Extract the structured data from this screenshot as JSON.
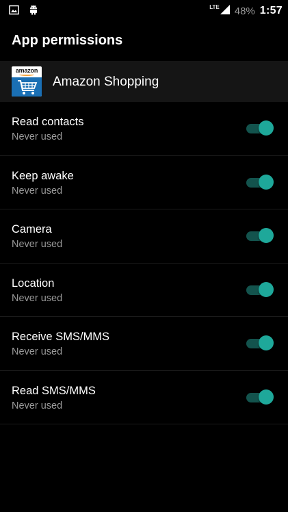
{
  "status_bar": {
    "network": "LTE",
    "battery": "48%",
    "time": "1:57"
  },
  "app_bar": {
    "title": "App permissions"
  },
  "app": {
    "name": "Amazon Shopping",
    "icon_logo_text": "amazon"
  },
  "permissions": [
    {
      "label": "Read contacts",
      "status": "Never used",
      "enabled": true
    },
    {
      "label": "Keep awake",
      "status": "Never used",
      "enabled": true
    },
    {
      "label": "Camera",
      "status": "Never used",
      "enabled": true
    },
    {
      "label": "Location",
      "status": "Never used",
      "enabled": true
    },
    {
      "label": "Receive SMS/MMS",
      "status": "Never used",
      "enabled": true
    },
    {
      "label": "Read SMS/MMS",
      "status": "Never used",
      "enabled": true
    }
  ],
  "colors": {
    "toggle_thumb": "#1ea89a",
    "toggle_track": "#13534d",
    "background": "#000000"
  }
}
